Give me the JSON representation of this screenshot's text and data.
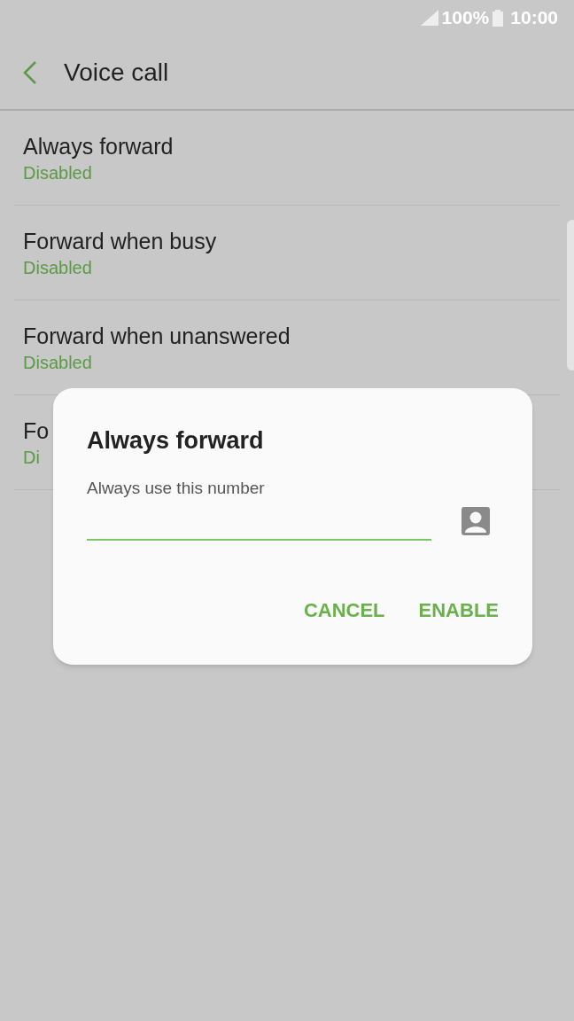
{
  "status_bar": {
    "battery": "100%",
    "time": "10:00"
  },
  "header": {
    "title": "Voice call"
  },
  "items": [
    {
      "title": "Always forward",
      "status": "Disabled"
    },
    {
      "title": "Forward when busy",
      "status": "Disabled"
    },
    {
      "title": "Forward when unanswered",
      "status": "Disabled"
    },
    {
      "title": "Fo",
      "status": "Di"
    }
  ],
  "dialog": {
    "title": "Always forward",
    "field_label": "Always use this number",
    "buttons": [
      "CANCEL",
      "ENABLE"
    ]
  }
}
